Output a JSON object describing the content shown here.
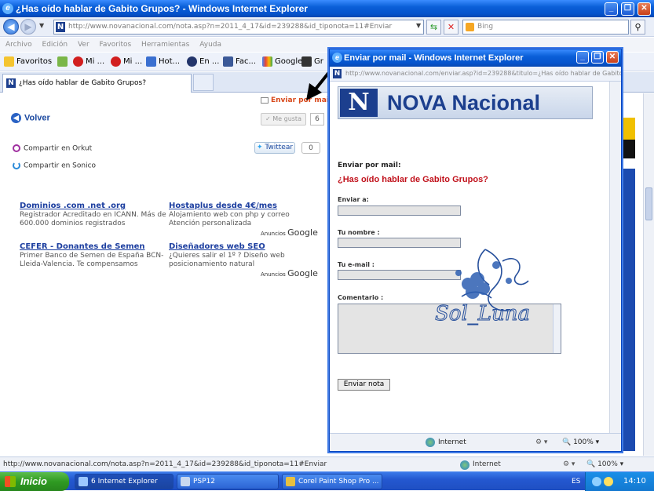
{
  "window": {
    "title": "¿Has oído hablar de Gabito Grupos? - Windows Internet Explorer"
  },
  "nav": {
    "address": "http://www.novanacional.com/nota.asp?n=2011_4_17&id=239288&id_tiponota=11#Enviar",
    "search_placeholder": "Bing"
  },
  "menu": [
    "Archivo",
    "Edición",
    "Ver",
    "Favoritos",
    "Herramientas",
    "Ayuda"
  ],
  "favorites": {
    "label": "Favoritos",
    "items": [
      "Mi ...",
      "Mi ...",
      "Hot...",
      "En ...",
      "Fac...",
      "Google",
      "Gr"
    ]
  },
  "tab": {
    "label": "¿Has oído hablar de Gabito Grupos?"
  },
  "page": {
    "enviar_mail": "Enviar por mail",
    "volver": "Volver",
    "me_gusta": "Me gusta",
    "me_gusta_count": "6",
    "orkut": "Compartir en Orkut",
    "sonico": "Compartir en Sonico",
    "tweet": "Twittear",
    "tweet_count": "0",
    "ads": [
      {
        "title": "Dominios .com .net .org",
        "text": "Registrador Acreditado en ICANN. Más de 600.000 dominios registrados"
      },
      {
        "title": "Hostaplus desde 4€/mes",
        "text": "Alojamiento web con php y correo Atención personalizada"
      },
      {
        "title": "CEFER - Donantes de Semen",
        "text": "Primer Banco de Semen de España BCN-Lleida-Valencia. Te compensamos"
      },
      {
        "title": "Diseñadores web SEO",
        "text": "¿Quieres salir el 1º ? Diseño web posicionamiento natural"
      }
    ],
    "ads_label": "Anuncios",
    "ads_brand": "Google"
  },
  "popup": {
    "title": "Enviar por mail - Windows Internet Explorer",
    "address": "http://www.novanacional.com/enviar.asp?id=239288&titulo=¿Has oído hablar de Gabito",
    "banner_letter": "N",
    "banner_text": "NOVA Nacional",
    "heading": "Enviar por mail:",
    "note_title": "¿Has oído hablar de Gabito Grupos?",
    "labels": {
      "to": "Enviar a:",
      "name": "Tu nombre :",
      "email": "Tu e-mail :",
      "comment": "Comentario :"
    },
    "send_button": "Enviar nota",
    "status_zone": "Internet",
    "status_zoom": "100%"
  },
  "watermark": "Sol_Luna",
  "status": {
    "url": "http://www.novanacional.com/nota.asp?n=2011_4_17&id=239288&id_tiponota=11#Enviar",
    "zone": "Internet",
    "zoom": "100%"
  },
  "taskbar": {
    "start": "Inicio",
    "tasks": [
      "6 Internet Explorer",
      "PSP12",
      "Corel Paint Shop Pro ..."
    ],
    "lang": "ES",
    "time": "14:10"
  },
  "colors": {
    "xp_blue": "#0553cc",
    "accent_red": "#c1121c",
    "link_blue": "#1d3fa0",
    "mail_orange": "#d8481a",
    "nova_blue": "#1c3f8e"
  }
}
